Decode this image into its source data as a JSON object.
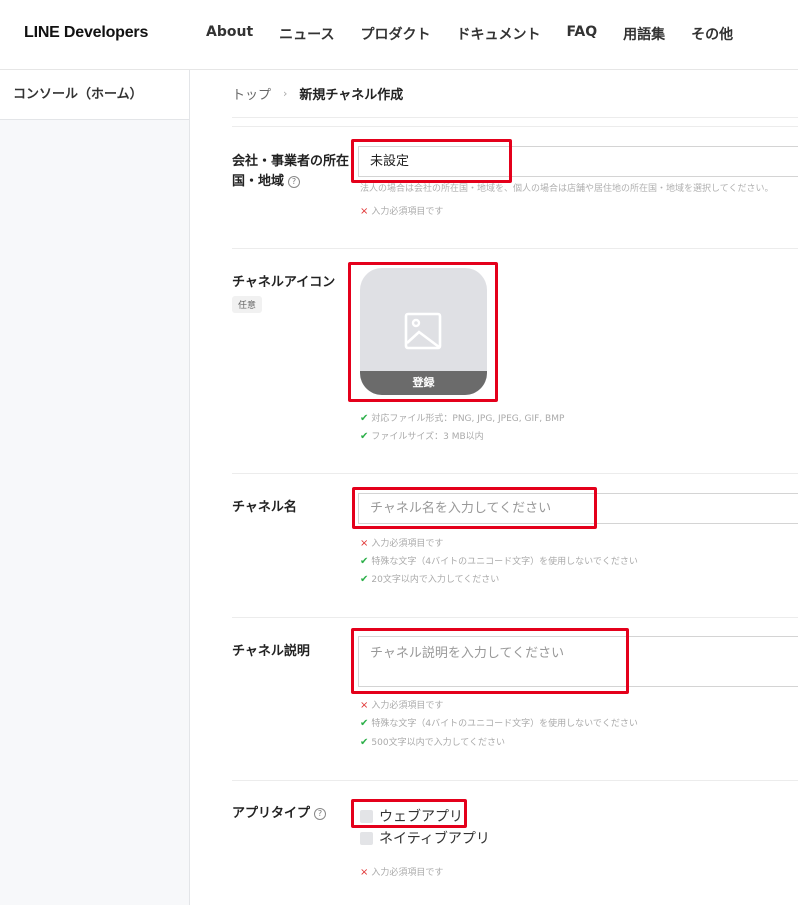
{
  "header": {
    "logo": "LINE Developers",
    "nav": [
      "About",
      "ニュース",
      "プロダクト",
      "ドキュメント",
      "FAQ",
      "用語集",
      "その他"
    ]
  },
  "sidebar": {
    "items": [
      {
        "label": "コンソール（ホーム）"
      }
    ]
  },
  "breadcrumb": {
    "top": "トップ",
    "current": "新規チャネル作成"
  },
  "form": {
    "country": {
      "label_line1": "会社・事業者の所在",
      "label_line2": "国・地域",
      "value": "未設定",
      "description": "法人の場合は会社の所在国・地域を、個人の場合は店舗や居住地の所在国・地域を選択してください。",
      "required": "入力必須項目です"
    },
    "channel_icon": {
      "label": "チャネルアイコン",
      "optional": "任意",
      "upload_label": "登録",
      "hints": [
        "対応ファイル形式：PNG, JPG, JPEG, GIF, BMP",
        "ファイルサイズ：3 MB以内"
      ]
    },
    "channel_name": {
      "label": "チャネル名",
      "placeholder": "チャネル名を入力してください",
      "required": "入力必須項目です",
      "hints": [
        "特殊な文字（4バイトのユニコード文字）を使用しないでください",
        "20文字以内で入力してください"
      ]
    },
    "channel_desc": {
      "label": "チャネル説明",
      "placeholder": "チャネル説明を入力してください",
      "required": "入力必須項目です",
      "hints": [
        "特殊な文字（4バイトのユニコード文字）を使用しないでください",
        "500文字以内で入力してください"
      ]
    },
    "app_type": {
      "label": "アプリタイプ",
      "options": [
        "ウェブアプリ",
        "ネイティブアプリ"
      ],
      "required": "入力必須項目です"
    }
  },
  "icons": {
    "help": "?",
    "x": "×",
    "check": "✔",
    "chevron": "›"
  },
  "colors": {
    "highlight": "#e4001b",
    "error": "#e03333",
    "ok": "#2db04a"
  }
}
